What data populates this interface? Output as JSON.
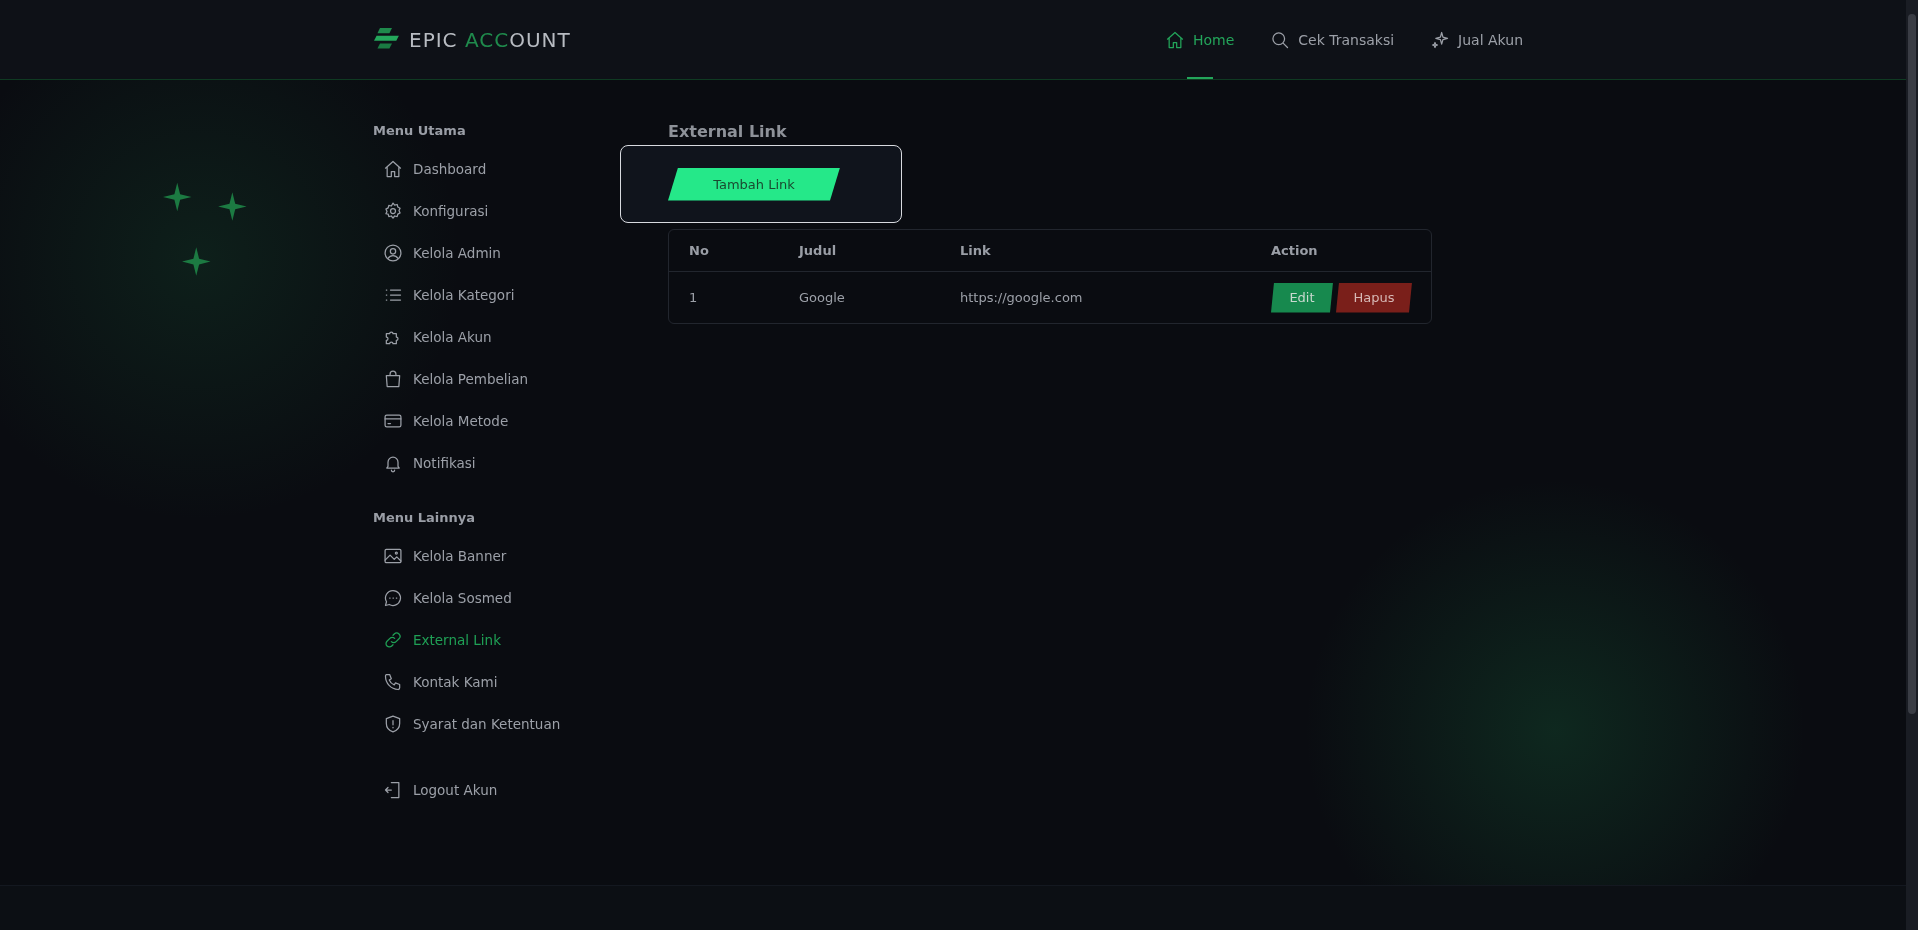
{
  "logo": {
    "text_1": "EPIC",
    "text_2": "ACC",
    "text_3": "OUNT"
  },
  "nav": [
    {
      "label": "Home",
      "selected": true
    },
    {
      "label": "Cek Transaksi",
      "selected": false
    },
    {
      "label": "Jual Akun",
      "selected": false
    }
  ],
  "sidebar": {
    "sections": [
      {
        "title": "Menu Utama",
        "items": [
          {
            "label": "Dashboard",
            "selected": false
          },
          {
            "label": "Konfigurasi",
            "selected": false
          },
          {
            "label": "Kelola Admin",
            "selected": false
          },
          {
            "label": "Kelola Kategori",
            "selected": false
          },
          {
            "label": "Kelola Akun",
            "selected": false
          },
          {
            "label": "Kelola Pembelian",
            "selected": false
          },
          {
            "label": "Kelola Metode",
            "selected": false
          },
          {
            "label": "Notifikasi",
            "selected": false
          }
        ]
      },
      {
        "title": "Menu Lainnya",
        "items": [
          {
            "label": "Kelola Banner",
            "selected": false
          },
          {
            "label": "Kelola Sosmed",
            "selected": false
          },
          {
            "label": "External Link",
            "selected": true
          },
          {
            "label": "Kontak Kami",
            "selected": false
          },
          {
            "label": "Syarat dan Ketentuan",
            "selected": false
          }
        ]
      }
    ],
    "logout": "Logout Akun"
  },
  "page_title": "External Link",
  "add_button": "Tambah Link",
  "table": {
    "columns": [
      "No",
      "Judul",
      "Link",
      "Action"
    ],
    "rows": [
      {
        "no": "1",
        "judul": "Google",
        "link": "https://google.com",
        "actions": [
          "Edit",
          "Hapus"
        ]
      }
    ]
  }
}
